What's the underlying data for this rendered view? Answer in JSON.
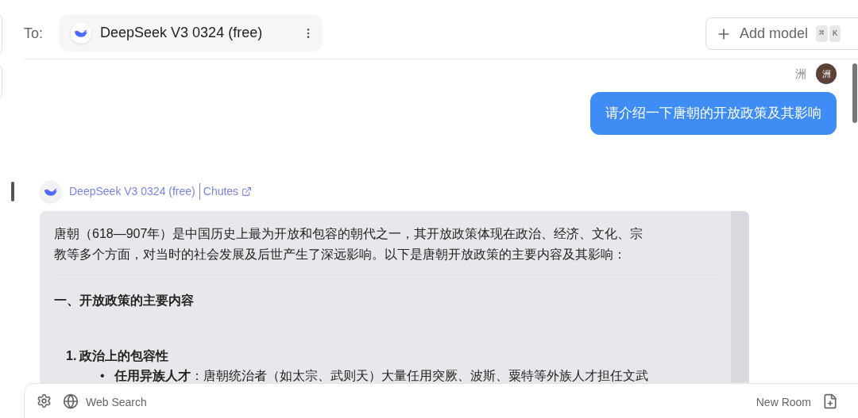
{
  "header": {
    "to_label": "To:",
    "model_chip": {
      "name": "DeepSeek V3 0324 (free)"
    },
    "add_model": {
      "label": "Add model",
      "shortcut": [
        "⌘",
        "K"
      ]
    }
  },
  "messages": [
    {
      "kind": "user",
      "author": "洲",
      "avatar": "洲",
      "text": "请介绍一下唐朝的开放政策及其影响"
    },
    {
      "kind": "assistant",
      "model": "DeepSeek V3 0324 (free)",
      "provider": "Chutes",
      "blocks": [
        {
          "kind": "paragraph",
          "text": "唐朝（618—907年）是中国历史上最为开放和包容的朝代之一，其开放政策体现在政治、经济、文化、宗教等多个方面，对当时的社会发展及后世产生了深远影响。以下是唐朝开放政策的主要内容及其影响："
        },
        {
          "kind": "heading",
          "text": "一、开放政策的主要内容"
        },
        {
          "kind": "numbered",
          "number": "1.",
          "text": "政治上的包容性"
        },
        {
          "kind": "bullet",
          "marker": "•",
          "text": "**任用异族人才**：唐朝统治者（如太宗、武则天）大量任用突厥、波斯、粟特等外族人才担任文武"
        }
      ]
    }
  ],
  "composer": {
    "web_search": "Web Search",
    "new_room": "New Room"
  }
}
